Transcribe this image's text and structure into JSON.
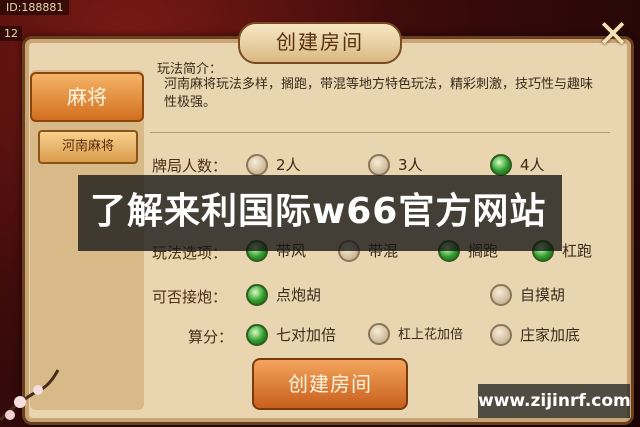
{
  "status": {
    "id_text": "ID:188881",
    "side_num": "12"
  },
  "dialog": {
    "title": "创建房间"
  },
  "sidebar": {
    "game": "麻将",
    "sub": "河南麻将"
  },
  "intro": {
    "heading": "玩法简介：",
    "body": "河南麻将玩法多样，搁跑，带混等地方特色玩法，精彩刺激，技巧性与趣味性极强。"
  },
  "players": {
    "label": "牌局人数：",
    "options": [
      {
        "text": "2人",
        "selected": false
      },
      {
        "text": "3人",
        "selected": false
      },
      {
        "text": "4人",
        "selected": true
      }
    ]
  },
  "rules": {
    "label": "玩法选项：",
    "options": [
      {
        "text": "带风",
        "selected": true
      },
      {
        "text": "带混",
        "selected": false
      },
      {
        "text": "搁跑",
        "selected": true
      },
      {
        "text": "杠跑",
        "selected": true
      }
    ]
  },
  "pao": {
    "label": "可否接炮：",
    "options": [
      {
        "text": "点炮胡",
        "selected": true
      },
      {
        "text": "自摸胡",
        "selected": false
      }
    ]
  },
  "score": {
    "label": "算分：",
    "options": [
      {
        "text": "七对加倍",
        "selected": true
      },
      {
        "text": "杠上花加倍",
        "selected": false
      },
      {
        "text": "庄家加底",
        "selected": false
      }
    ]
  },
  "create_button": "创建房间",
  "overlay": {
    "banner": "了解来利国际w66官方网站",
    "watermark": "www.zijinrf.com"
  },
  "colors": {
    "accent": "#d26f1f",
    "selected": "#2f9b2a",
    "panel": "#e9d6b0"
  }
}
